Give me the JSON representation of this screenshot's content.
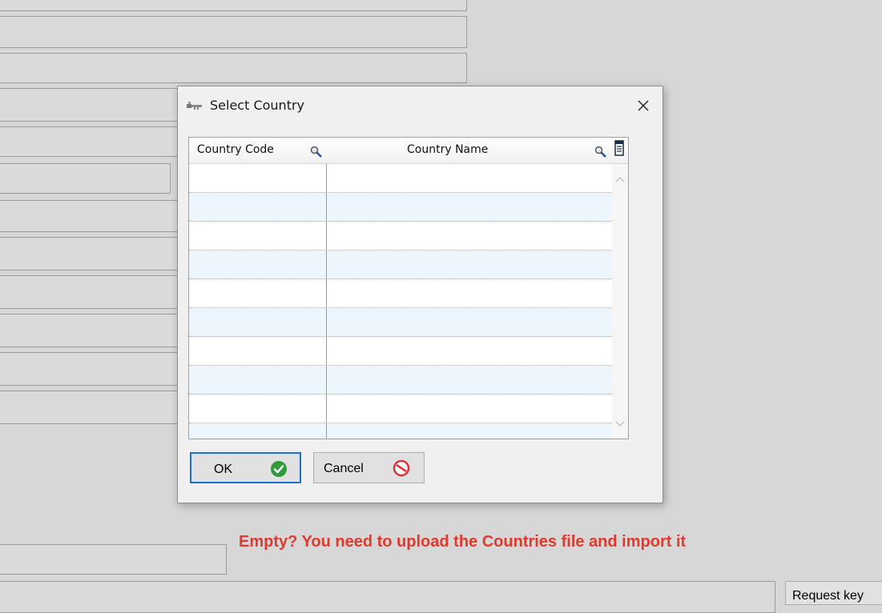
{
  "dialog": {
    "title": "Select Country",
    "title_icon": "key-icon",
    "close_icon": "close-icon"
  },
  "grid": {
    "columns": [
      {
        "label": "Country Code",
        "icon": "magnifier-icon"
      },
      {
        "label": "Country Name",
        "icon": "magnifier-icon"
      }
    ],
    "rows": [],
    "column_chooser_icon": "column-chooser-icon"
  },
  "buttons": {
    "ok_label": "OK",
    "ok_icon": "green-check-icon",
    "cancel_label": "Cancel",
    "cancel_icon": "no-entry-icon"
  },
  "hint": "Empty? You need to upload the Countries file and import it",
  "background": {
    "request_button_label": "Request key"
  },
  "colors": {
    "hint": "#e03a2e",
    "ok_border": "#1f6fc6",
    "alt_row": "#eef6fd",
    "check_green": "#2f9a3a",
    "cancel_red": "#d9363e"
  }
}
